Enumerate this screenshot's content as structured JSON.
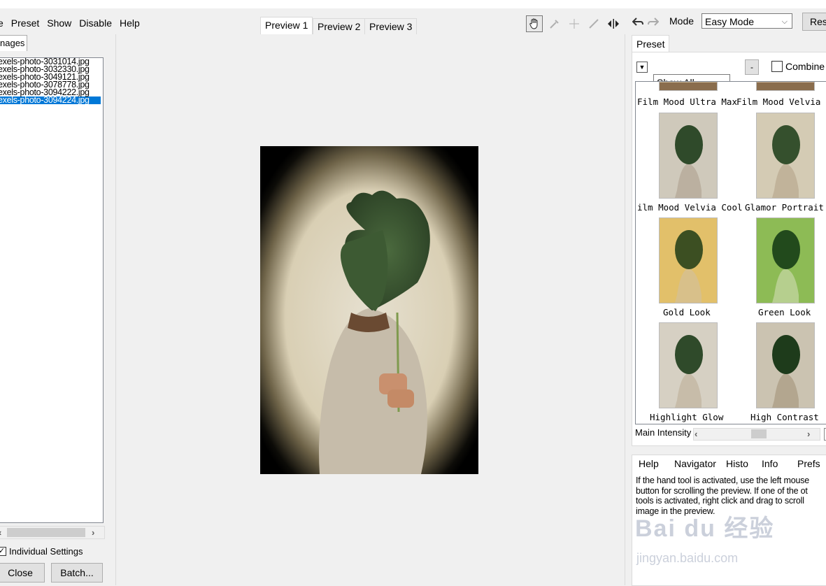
{
  "menu": [
    "e",
    "Preset",
    "Show",
    "Disable",
    "Help"
  ],
  "left": {
    "tab": "nages",
    "files": [
      "exels-photo-3031014.jpg",
      "exels-photo-3032330.jpg",
      "exels-photo-3049121.jpg",
      "exels-photo-3078778.jpg",
      "exels-photo-3094222.jpg",
      "exels-photo-3094224.jpg"
    ],
    "selected_index": 5,
    "individual_settings": "Individual Settings",
    "close": "Close",
    "batch": "Batch..."
  },
  "preview_tabs": [
    "Preview 1",
    "Preview 2",
    "Preview 3"
  ],
  "toolbar": {
    "mode_label": "Mode",
    "mode_value": "Easy Mode",
    "reset_label": "Res"
  },
  "preset": {
    "tab": "Preset",
    "show_all": "Show All",
    "minus": "-",
    "combine": "Combine",
    "items": [
      "Film Mood Ultra Max",
      "Film Mood Velvia",
      "ilm Mood Velvia Cool",
      "Glamor Portrait",
      "Gold Look",
      "Green Look",
      "Highlight Glow",
      "High Contrast"
    ]
  },
  "intensity": {
    "label": "Main Intensity"
  },
  "help": {
    "tabs": [
      "Help",
      "Navigator",
      "Histo",
      "Info",
      "Prefs"
    ],
    "lines": [
      "If the hand tool is activated, use the left mouse",
      "button for scrolling the preview. If one of the ot",
      "tools is activated, right click and drag to scroll",
      "image in the preview."
    ]
  },
  "watermark": {
    "logo": "Bai du 经验",
    "url": "jingyan.baidu.com"
  },
  "colors": {
    "selection": "#0078d7",
    "panel": "#f0f0f0"
  }
}
